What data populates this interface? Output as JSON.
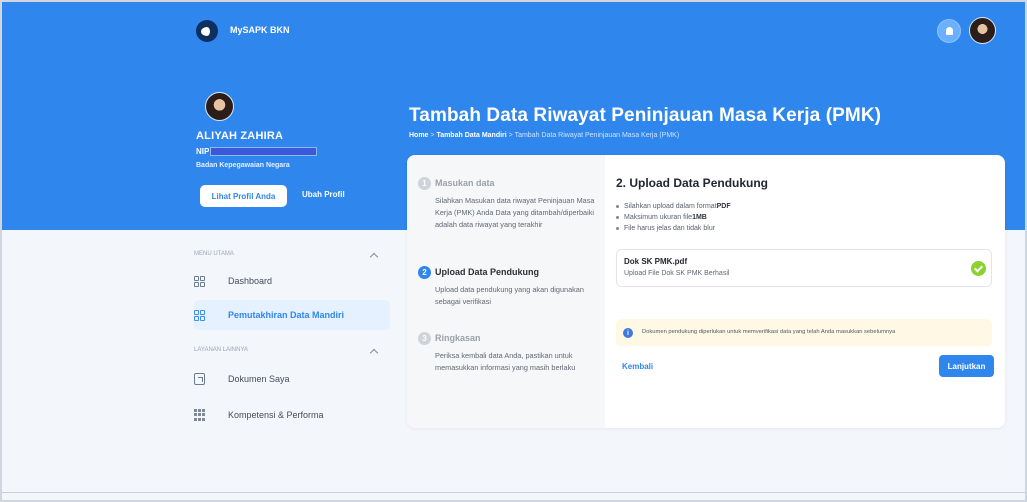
{
  "app": {
    "brand": "MySAPK BKN"
  },
  "header": {
    "page_title": "Tambah Data Riwayat Peninjauan Masa Kerja (PMK)",
    "breadcrumb": {
      "home": "Home",
      "separator1": " > ",
      "add": "Tambah Data Mandiri",
      "separator2": " > ",
      "current": "Tambah Data Riwayat Peninjauan Masa Kerja (PMK)"
    },
    "icons": {
      "notification": "bell-icon",
      "avatar": "user-avatar"
    }
  },
  "profile": {
    "name": "ALIYAH ZAHIRA",
    "nip_label": "NIP",
    "agency": "Badan Kepegawaian Negara",
    "view_profile": "Lihat Profil Anda",
    "edit_profile": "Ubah Profil"
  },
  "sidebar": {
    "main_menu": "MENU UTAMA",
    "other_services": "LAYANAN LAINNYA",
    "items": [
      {
        "label": "Dashboard",
        "icon": "dashboard-icon"
      },
      {
        "label": "Pemutakhiran Data Mandiri",
        "icon": "data-update-icon"
      },
      {
        "label": "Dokumen Saya",
        "icon": "document-icon"
      },
      {
        "label": "Kompetensi & Performa",
        "icon": "performance-icon"
      }
    ]
  },
  "wizard": {
    "steps": [
      {
        "number": "1",
        "title": "Masukan data",
        "description": "Silahkan Masukan data riwayat Peninjauan Masa Kerja (PMK) Anda Data yang ditambah/diperbaiki adalah data riwayat yang terakhir"
      },
      {
        "number": "2",
        "title": "Upload Data Pendukung",
        "description": "Upload data pendukung yang akan digunakan sebagai verifikasi"
      },
      {
        "number": "3",
        "title": "Ringkasan",
        "description": "Periksa kembali data Anda, pastikan untuk memasukkan informasi yang masih berlaku"
      }
    ]
  },
  "upload": {
    "title": "2. Upload Data Pendukung",
    "requirements": {
      "format_prefix": "Silahkan upload dalam format ",
      "format": "PDF",
      "size_prefix": "Maksimum ukuran file ",
      "size": "1MB",
      "clear": "File harus jelas dan tidak blur"
    },
    "file": {
      "name": "Dok SK PMK.pdf",
      "status": "Upload File Dok SK PMK Berhasil"
    },
    "note": "Dokumen pendukung diperlukan untuk memverifikasi data yang telah Anda masukkan sebelumnya",
    "back": "Kembali",
    "next": "Lanjutkan"
  },
  "colors": {
    "primary": "#2f86ec",
    "background": "#f3f6fb",
    "success": "#8bd12f",
    "notice": "#fff8e4"
  }
}
